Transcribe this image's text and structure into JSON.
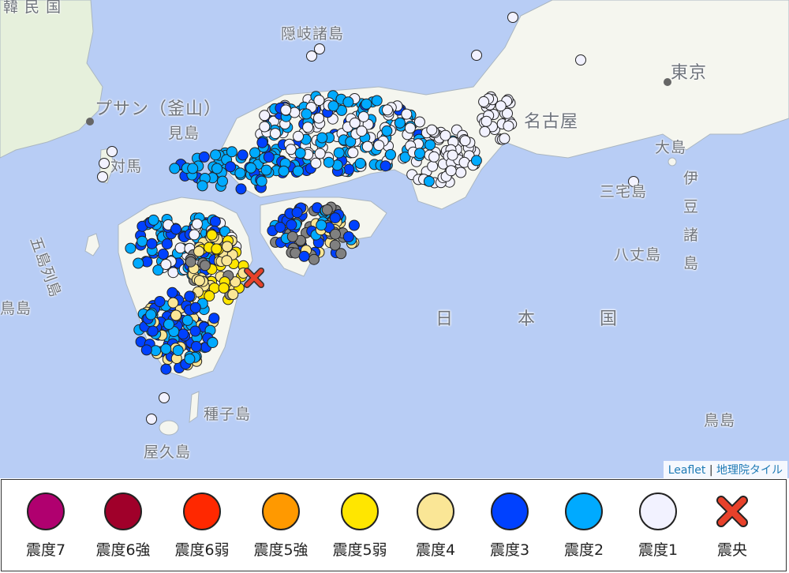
{
  "map": {
    "places": [
      {
        "id": "korea",
        "text": "韓 民 国"
      },
      {
        "id": "oki",
        "text": "隠岐諸島"
      },
      {
        "id": "busan",
        "text": "プサン（釜山）"
      },
      {
        "id": "mishima",
        "text": "見島"
      },
      {
        "id": "tsushima",
        "text": "対馬"
      },
      {
        "id": "goto",
        "text": "五島列島"
      },
      {
        "id": "koshiki",
        "text": "鳥島"
      },
      {
        "id": "tokyo",
        "text": "東京"
      },
      {
        "id": "nagoya",
        "text": "名古屋"
      },
      {
        "id": "oshima",
        "text": "大島"
      },
      {
        "id": "miyake",
        "text": "三宅島"
      },
      {
        "id": "hachijo",
        "text": "八丈島"
      },
      {
        "id": "izu",
        "text": "伊豆諸島"
      },
      {
        "id": "nihonkoku",
        "text": "日本国"
      },
      {
        "id": "tanegashima",
        "text": "種子島"
      },
      {
        "id": "yakushima",
        "text": "屋久島"
      },
      {
        "id": "torishima",
        "text": "鳥島"
      }
    ],
    "attribution": {
      "leaflet": "Leaflet",
      "separator": "|",
      "tiles": "地理院タイル"
    },
    "colors": {
      "sea": "#b8cdf5",
      "land": "#f5f6ef",
      "land_green": "#e4f0dc"
    }
  },
  "legend": [
    {
      "label": "震度7",
      "color": "#b0006f",
      "kind": "circle"
    },
    {
      "label": "震度6強",
      "color": "#a0002a",
      "kind": "circle"
    },
    {
      "label": "震度6弱",
      "color": "#ff2800",
      "kind": "circle"
    },
    {
      "label": "震度5強",
      "color": "#ff9900",
      "kind": "circle"
    },
    {
      "label": "震度5弱",
      "color": "#ffe600",
      "kind": "circle"
    },
    {
      "label": "震度4",
      "color": "#fae696",
      "kind": "circle"
    },
    {
      "label": "震度3",
      "color": "#0041ff",
      "kind": "circle"
    },
    {
      "label": "震度2",
      "color": "#00aaff",
      "kind": "circle"
    },
    {
      "label": "震度1",
      "color": "#f2f2ff",
      "kind": "circle"
    },
    {
      "label": "震央",
      "color": "#e8412a",
      "kind": "cross"
    }
  ]
}
